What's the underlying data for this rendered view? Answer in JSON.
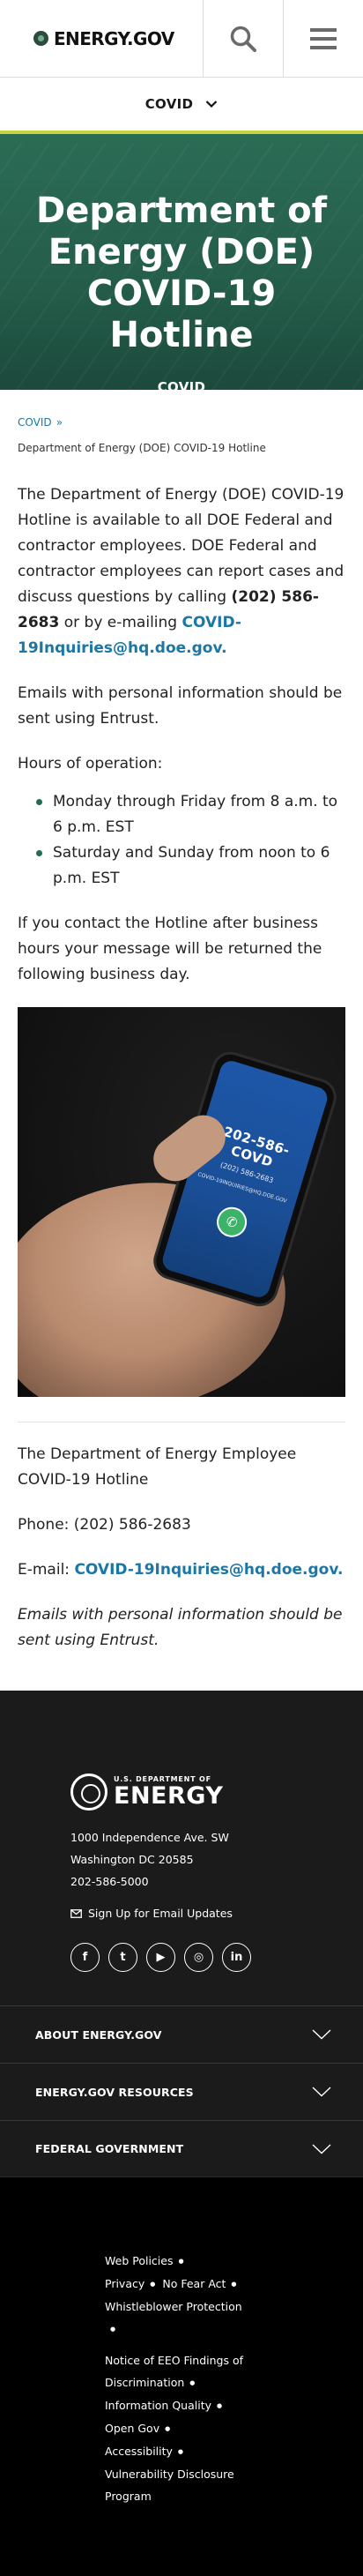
{
  "header": {
    "logo_text": "ENERGY.GOV",
    "search_icon": "search-icon",
    "menu_icon": "hamburger-menu-icon"
  },
  "topic_bar": {
    "label": "COVID",
    "icon": "chevron-down-icon"
  },
  "hero": {
    "title": "Department of Energy (DOE) COVID-19 Hotline",
    "tag": "COVID"
  },
  "breadcrumb": {
    "link": "COVID",
    "separator": "»",
    "current": "Department of Energy (DOE) COVID-19 Hotline"
  },
  "content": {
    "p1_a": "The Department of Energy (DOE) COVID-19 Hotline is available to all DOE Federal and contractor employees.  DOE Federal and contractor employees can report cases and discuss questions by calling ",
    "p1_phone": "(202) 586-2683",
    "p1_b": " or by e-mailing ",
    "p1_email": "COVID-19Inquiries@hq.doe.gov",
    "p1_c": ".",
    "p2": "Emails with personal information should be sent using Entrust.",
    "p3": "Hours of operation:",
    "hours": [
      "Monday through Friday from 8 a.m. to 6 p.m. EST",
      "Saturday and Sunday from noon to 6 p.m. EST"
    ],
    "p4": "If you contact the Hotline after business hours your message will be returned the following business day.",
    "image": {
      "phone_number": "202-586-COVD",
      "phone_sub": "(202) 586-2683",
      "phone_email": "COVID-19INQUIRIES@HQ.DOE.GOV"
    },
    "contact_title": "The Department of Energy Employee COVID-19 Hotline",
    "phone_line_label": "Phone: ",
    "phone_line_value": "(202) 586-2683",
    "email_line_label": "E-mail: ",
    "email_line_value": "COVID-19Inquiries@hq.doe.gov.",
    "note": "Emails with personal information should be sent using Entrust."
  },
  "footer": {
    "logo_small": "U.S. DEPARTMENT OF",
    "logo_big": "ENERGY",
    "address": [
      "1000 Independence Ave. SW",
      "Washington DC 20585",
      "202-586-5000"
    ],
    "signup": "Sign Up for Email Updates",
    "social": [
      {
        "name": "facebook",
        "glyph": "f"
      },
      {
        "name": "twitter",
        "glyph": "t"
      },
      {
        "name": "youtube",
        "glyph": "▶"
      },
      {
        "name": "instagram",
        "glyph": "◎"
      },
      {
        "name": "linkedin",
        "glyph": "in"
      }
    ],
    "accordions": [
      "ABOUT ENERGY.GOV",
      "ENERGY.GOV RESOURCES",
      "FEDERAL GOVERNMENT"
    ],
    "legal": [
      "Web Policies",
      "Privacy",
      "No Fear Act",
      "Whistleblower Protection",
      "Notice of EEO Findings of Discrimination",
      "Information Quality",
      "Open Gov",
      "Accessibility",
      "Vulnerability Disclosure Program"
    ]
  },
  "colors": {
    "link": "#1a77a6",
    "hero_green": "#2b6c55",
    "topic_underline": "#c9d33b",
    "footer_bg": "#1b1b1b"
  }
}
